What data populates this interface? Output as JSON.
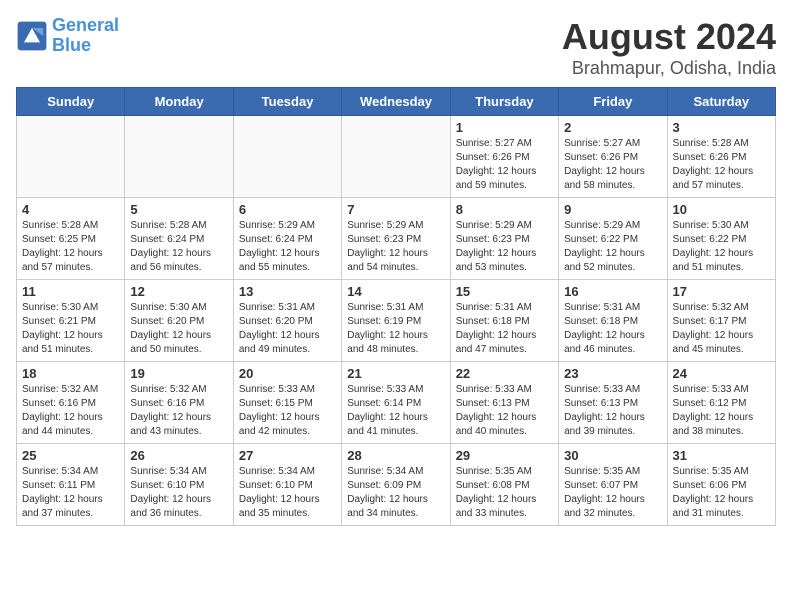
{
  "logo": {
    "line1": "General",
    "line2": "Blue"
  },
  "title": "August 2024",
  "subtitle": "Brahmapur, Odisha, India",
  "weekdays": [
    "Sunday",
    "Monday",
    "Tuesday",
    "Wednesday",
    "Thursday",
    "Friday",
    "Saturday"
  ],
  "weeks": [
    [
      {
        "day": "",
        "info": ""
      },
      {
        "day": "",
        "info": ""
      },
      {
        "day": "",
        "info": ""
      },
      {
        "day": "",
        "info": ""
      },
      {
        "day": "1",
        "info": "Sunrise: 5:27 AM\nSunset: 6:26 PM\nDaylight: 12 hours\nand 59 minutes."
      },
      {
        "day": "2",
        "info": "Sunrise: 5:27 AM\nSunset: 6:26 PM\nDaylight: 12 hours\nand 58 minutes."
      },
      {
        "day": "3",
        "info": "Sunrise: 5:28 AM\nSunset: 6:26 PM\nDaylight: 12 hours\nand 57 minutes."
      }
    ],
    [
      {
        "day": "4",
        "info": "Sunrise: 5:28 AM\nSunset: 6:25 PM\nDaylight: 12 hours\nand 57 minutes."
      },
      {
        "day": "5",
        "info": "Sunrise: 5:28 AM\nSunset: 6:24 PM\nDaylight: 12 hours\nand 56 minutes."
      },
      {
        "day": "6",
        "info": "Sunrise: 5:29 AM\nSunset: 6:24 PM\nDaylight: 12 hours\nand 55 minutes."
      },
      {
        "day": "7",
        "info": "Sunrise: 5:29 AM\nSunset: 6:23 PM\nDaylight: 12 hours\nand 54 minutes."
      },
      {
        "day": "8",
        "info": "Sunrise: 5:29 AM\nSunset: 6:23 PM\nDaylight: 12 hours\nand 53 minutes."
      },
      {
        "day": "9",
        "info": "Sunrise: 5:29 AM\nSunset: 6:22 PM\nDaylight: 12 hours\nand 52 minutes."
      },
      {
        "day": "10",
        "info": "Sunrise: 5:30 AM\nSunset: 6:22 PM\nDaylight: 12 hours\nand 51 minutes."
      }
    ],
    [
      {
        "day": "11",
        "info": "Sunrise: 5:30 AM\nSunset: 6:21 PM\nDaylight: 12 hours\nand 51 minutes."
      },
      {
        "day": "12",
        "info": "Sunrise: 5:30 AM\nSunset: 6:20 PM\nDaylight: 12 hours\nand 50 minutes."
      },
      {
        "day": "13",
        "info": "Sunrise: 5:31 AM\nSunset: 6:20 PM\nDaylight: 12 hours\nand 49 minutes."
      },
      {
        "day": "14",
        "info": "Sunrise: 5:31 AM\nSunset: 6:19 PM\nDaylight: 12 hours\nand 48 minutes."
      },
      {
        "day": "15",
        "info": "Sunrise: 5:31 AM\nSunset: 6:18 PM\nDaylight: 12 hours\nand 47 minutes."
      },
      {
        "day": "16",
        "info": "Sunrise: 5:31 AM\nSunset: 6:18 PM\nDaylight: 12 hours\nand 46 minutes."
      },
      {
        "day": "17",
        "info": "Sunrise: 5:32 AM\nSunset: 6:17 PM\nDaylight: 12 hours\nand 45 minutes."
      }
    ],
    [
      {
        "day": "18",
        "info": "Sunrise: 5:32 AM\nSunset: 6:16 PM\nDaylight: 12 hours\nand 44 minutes."
      },
      {
        "day": "19",
        "info": "Sunrise: 5:32 AM\nSunset: 6:16 PM\nDaylight: 12 hours\nand 43 minutes."
      },
      {
        "day": "20",
        "info": "Sunrise: 5:33 AM\nSunset: 6:15 PM\nDaylight: 12 hours\nand 42 minutes."
      },
      {
        "day": "21",
        "info": "Sunrise: 5:33 AM\nSunset: 6:14 PM\nDaylight: 12 hours\nand 41 minutes."
      },
      {
        "day": "22",
        "info": "Sunrise: 5:33 AM\nSunset: 6:13 PM\nDaylight: 12 hours\nand 40 minutes."
      },
      {
        "day": "23",
        "info": "Sunrise: 5:33 AM\nSunset: 6:13 PM\nDaylight: 12 hours\nand 39 minutes."
      },
      {
        "day": "24",
        "info": "Sunrise: 5:33 AM\nSunset: 6:12 PM\nDaylight: 12 hours\nand 38 minutes."
      }
    ],
    [
      {
        "day": "25",
        "info": "Sunrise: 5:34 AM\nSunset: 6:11 PM\nDaylight: 12 hours\nand 37 minutes."
      },
      {
        "day": "26",
        "info": "Sunrise: 5:34 AM\nSunset: 6:10 PM\nDaylight: 12 hours\nand 36 minutes."
      },
      {
        "day": "27",
        "info": "Sunrise: 5:34 AM\nSunset: 6:10 PM\nDaylight: 12 hours\nand 35 minutes."
      },
      {
        "day": "28",
        "info": "Sunrise: 5:34 AM\nSunset: 6:09 PM\nDaylight: 12 hours\nand 34 minutes."
      },
      {
        "day": "29",
        "info": "Sunrise: 5:35 AM\nSunset: 6:08 PM\nDaylight: 12 hours\nand 33 minutes."
      },
      {
        "day": "30",
        "info": "Sunrise: 5:35 AM\nSunset: 6:07 PM\nDaylight: 12 hours\nand 32 minutes."
      },
      {
        "day": "31",
        "info": "Sunrise: 5:35 AM\nSunset: 6:06 PM\nDaylight: 12 hours\nand 31 minutes."
      }
    ]
  ]
}
